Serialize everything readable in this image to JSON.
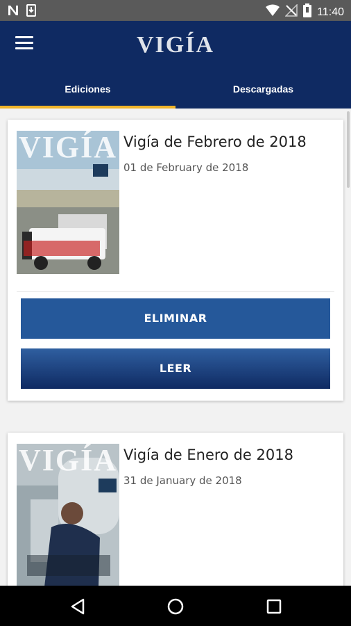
{
  "status_bar": {
    "time": "11:40",
    "left_icons": [
      "notification-n-icon",
      "download-icon"
    ],
    "right_icons": [
      "wifi-icon",
      "no-signal-icon",
      "battery-icon"
    ]
  },
  "app_bar": {
    "title": "VIGÍA",
    "menu_icon": "hamburger-icon"
  },
  "tabs": [
    {
      "label": "Ediciones",
      "active": true
    },
    {
      "label": "Descargadas",
      "active": false
    }
  ],
  "editions": [
    {
      "title": "Vigía de Febrero de 2018",
      "date": "01 de February de 2018",
      "cover_masthead": "VIGÍA",
      "delete_label": "ELIMINAR",
      "read_label": "LEER"
    },
    {
      "title": "Vigía de Enero de 2018",
      "date": "31 de January de 2018",
      "cover_masthead": "VIGÍA"
    }
  ],
  "colors": {
    "primary": "#0f2a62",
    "button_blue": "#25589a",
    "tab_indicator": "#f0b429"
  },
  "nav_bar": {
    "icons": [
      "back-icon",
      "home-icon",
      "recents-icon"
    ]
  }
}
